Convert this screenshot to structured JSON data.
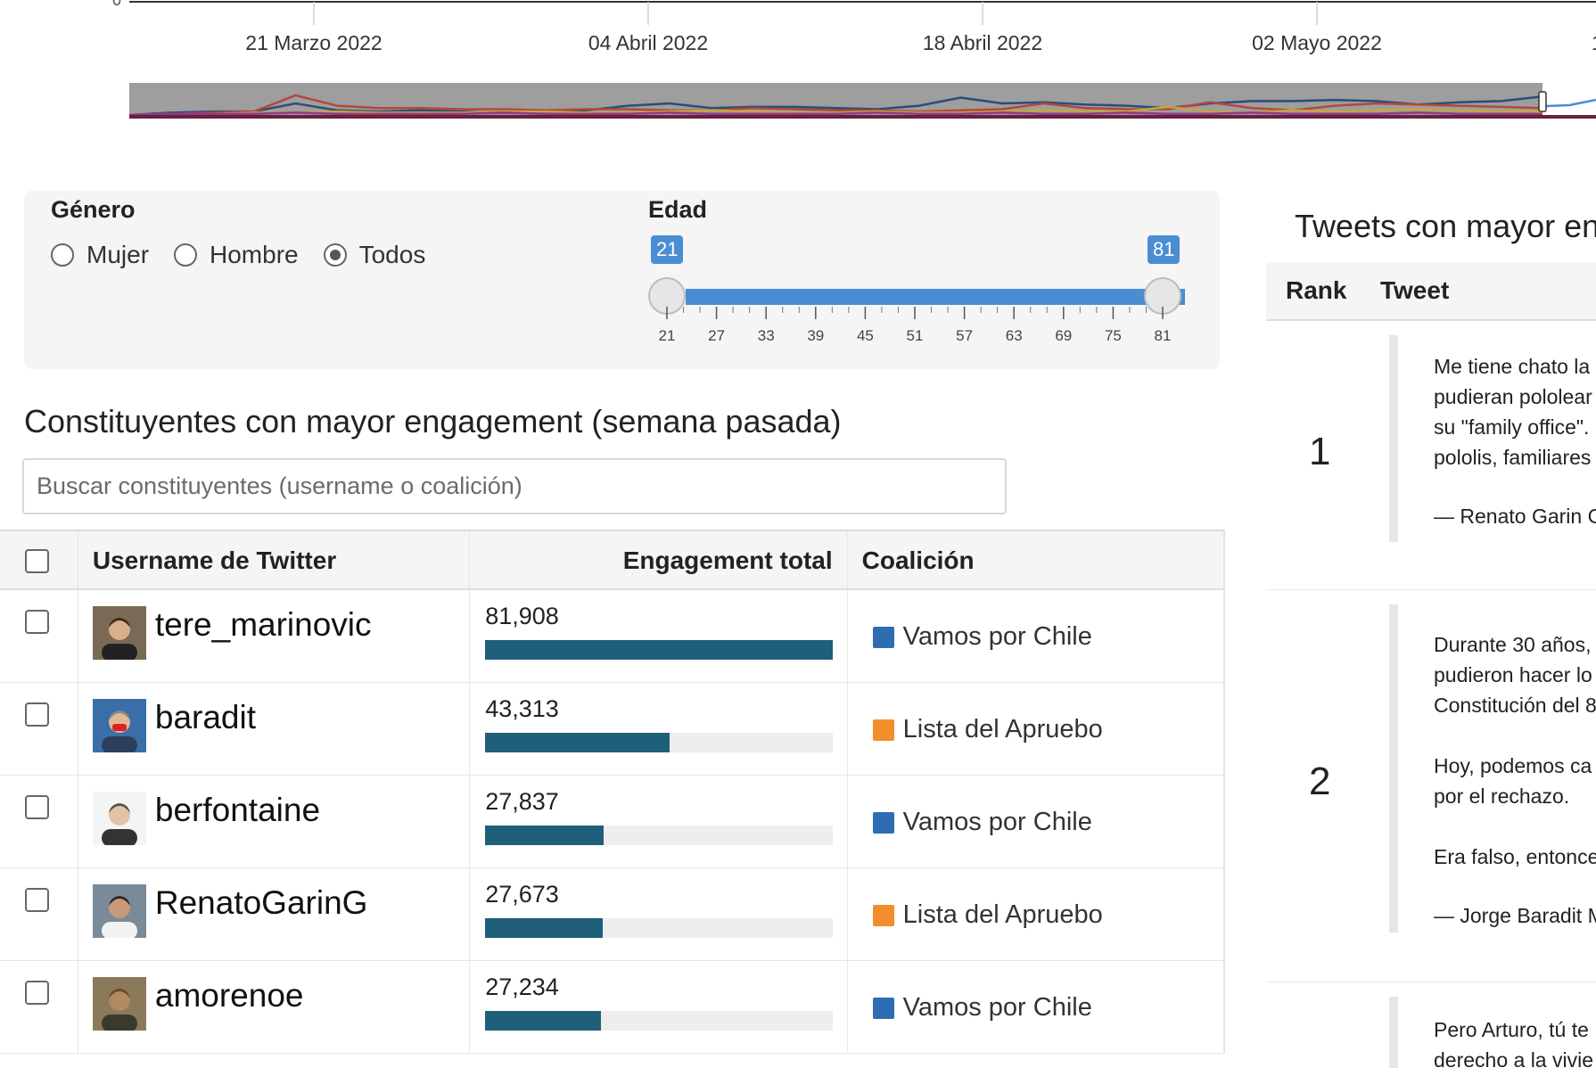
{
  "timeline": {
    "y_axis_zero_label": "0",
    "x_tick_labels": [
      "21 Marzo 2022",
      "04 Abril 2022",
      "18 Abril 2022",
      "02 Mayo 2022",
      "1"
    ],
    "navigator_colors": [
      "#2a4d7a",
      "#b5473a",
      "#c9a33e",
      "#8a3a8a",
      "#4a4a4a",
      "#4a8dd3"
    ]
  },
  "filters": {
    "gender": {
      "label": "Género",
      "options": [
        "Mujer",
        "Hombre",
        "Todos"
      ],
      "selected": "Todos"
    },
    "age": {
      "label": "Edad",
      "min_value": "21",
      "max_value": "81",
      "range_fraction": [
        0,
        1
      ],
      "tick_labels": [
        "21",
        "27",
        "33",
        "39",
        "45",
        "51",
        "57",
        "63",
        "69",
        "75",
        "81"
      ]
    }
  },
  "constituents": {
    "title": "Constituyentes con mayor engagement (semana pasada)",
    "search_placeholder": "Buscar constituyentes (username o coalición)",
    "columns": [
      "Username de Twitter",
      "Engagement total",
      "Coalición"
    ],
    "rows": [
      {
        "username": "tere_marinovic",
        "engagement": "81,908",
        "engagement_fraction": 1.0,
        "coalition": "Vamos por Chile",
        "coalition_color": "#2f6db3",
        "avatar": "avatar-1"
      },
      {
        "username": "baradit",
        "engagement": "43,313",
        "engagement_fraction": 0.529,
        "coalition": "Lista del Apruebo",
        "coalition_color": "#f28e2b",
        "avatar": "avatar-2"
      },
      {
        "username": "berfontaine",
        "engagement": "27,837",
        "engagement_fraction": 0.34,
        "coalition": "Vamos por Chile",
        "coalition_color": "#2f6db3",
        "avatar": "avatar-3"
      },
      {
        "username": "RenatoGarinG",
        "engagement": "27,673",
        "engagement_fraction": 0.338,
        "coalition": "Lista del Apruebo",
        "coalition_color": "#f28e2b",
        "avatar": "avatar-4"
      },
      {
        "username": "amorenoe",
        "engagement": "27,234",
        "engagement_fraction": 0.333,
        "coalition": "Vamos por Chile",
        "coalition_color": "#2f6db3",
        "avatar": "avatar-5"
      }
    ]
  },
  "tweets": {
    "title": "Tweets con mayor en",
    "columns": [
      "Rank",
      "Tweet"
    ],
    "rows": [
      {
        "rank": "1",
        "lines": [
          "Me tiene chato la",
          "pudieran pololear",
          "su \"family office\".",
          "pololis, familiares",
          "",
          "— Renato Garin G"
        ]
      },
      {
        "rank": "2",
        "lines": [
          "Durante 30 años,",
          "pudieron hacer lo",
          "Constitución del 8",
          "",
          "Hoy, podemos ca",
          "por el rechazo.",
          "",
          "Era falso, entonce",
          "",
          "— Jorge Baradit M"
        ]
      },
      {
        "rank": "",
        "lines": [
          "Pero Arturo, tú te",
          "derecho a la vivie"
        ]
      }
    ]
  }
}
